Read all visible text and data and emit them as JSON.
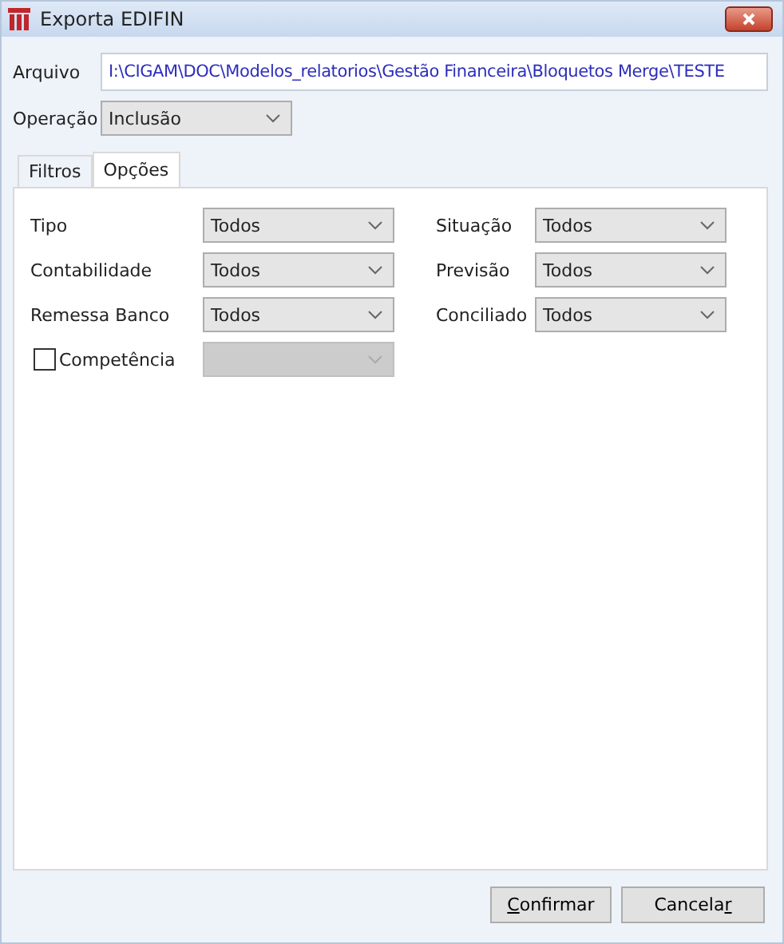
{
  "window": {
    "title": "Exporta EDIFIN"
  },
  "arquivo": {
    "label": "Arquivo",
    "value": "I:\\CIGAM\\DOC\\Modelos_relatorios\\Gestão Financeira\\Bloquetos Merge\\TESTE"
  },
  "operacao": {
    "label": "Operação",
    "value": "Inclusão"
  },
  "tabs": [
    {
      "label": "Filtros",
      "selected": false
    },
    {
      "label": "Opções",
      "selected": true
    }
  ],
  "options": [
    {
      "kind": "combo",
      "label": "Tipo",
      "value": "Todos",
      "disabled": false
    },
    {
      "kind": "combo",
      "label": "Situação",
      "value": "Todos",
      "disabled": false
    },
    {
      "kind": "combo",
      "label": "Contabilidade",
      "value": "Todos",
      "disabled": false
    },
    {
      "kind": "combo",
      "label": "Previsão",
      "value": "Todos",
      "disabled": false
    },
    {
      "kind": "combo",
      "label": "Remessa Banco",
      "value": "Todos",
      "disabled": false
    },
    {
      "kind": "combo",
      "label": "Conciliado",
      "value": "Todos",
      "disabled": false
    },
    {
      "kind": "check",
      "label": "Competência",
      "checked": false,
      "disabled": true
    }
  ],
  "buttons": [
    {
      "access_key": "C",
      "after_key": "onfirmar"
    },
    {
      "before_key": "Cancela",
      "access_key": "r"
    }
  ]
}
